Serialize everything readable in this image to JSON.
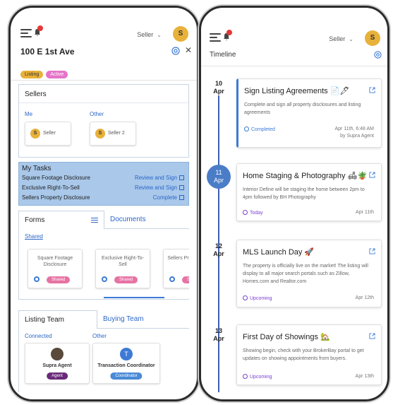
{
  "left": {
    "seller_label": "Seller",
    "avatar_letter": "S",
    "property_title": "100 E 1st Ave",
    "chips": [
      "Listing",
      "Active"
    ],
    "sellers": {
      "title": "Sellers",
      "me_label": "Me",
      "other_label": "Other",
      "me_card": {
        "letter": "S",
        "name": "Seller"
      },
      "other_card": {
        "letter": "S",
        "name": "Seller 2"
      }
    },
    "tasks": {
      "title": "My Tasks",
      "rows": [
        {
          "name": "Square Footage Disclosure",
          "action": "Review and Sign"
        },
        {
          "name": "Exclusive Right-To-Sell",
          "action": "Review and Sign"
        },
        {
          "name": "Sellers Property Disclosure",
          "action": "Complete"
        }
      ]
    },
    "forms_tab": "Forms",
    "documents_tab": "Documents",
    "shared_link": "Shared",
    "form_cards": [
      {
        "name": "Square Footage Disclosure",
        "badge": "Shared"
      },
      {
        "name": "Exclusive Right-To-Sell",
        "badge": "Shared"
      },
      {
        "name": "Sellers Property Disc",
        "badge": "Sh"
      }
    ],
    "listing_team_tab": "Listing Team",
    "buying_team_tab": "Buying Team",
    "connected_label": "Connected",
    "team_other_label": "Other",
    "team_cards": [
      {
        "name": "Supra Agent",
        "badge": "Agent"
      },
      {
        "name": "Transaction Coordinator",
        "badge": "Coordinator",
        "letter": "T"
      }
    ]
  },
  "right": {
    "seller_label": "Seller",
    "avatar_letter": "S",
    "timeline_title": "Timeline",
    "events": [
      {
        "day": "10",
        "month": "Apr",
        "title": "Sign Listing Agreements 📄🖊",
        "desc": "Complete and sign all property disclosures and listing agreements",
        "status": "Completed",
        "date": "Apr 11th, 6:48 AM",
        "by": "by Supra Agent"
      },
      {
        "day": "11",
        "month": "Apr",
        "title": "Home Staging & Photography 🛋🪴",
        "desc": "Interior Define will be staging the home between 2pm to 4pm followed by BH Photography",
        "status": "Today",
        "date": "Apr 11th"
      },
      {
        "day": "12",
        "month": "Apr",
        "title": "MLS Launch Day 🚀",
        "desc": "The property is officially live on the market! The listing will display to all major search portals such as Zillow, Homes.com and Realtor.com",
        "status": "Upcoming",
        "date": "Apr 12th"
      },
      {
        "day": "13",
        "month": "Apr",
        "title": "First Day of Showings 🏡",
        "desc": "Showing begin, check with your BrokerBay portal to get updates on showing appointments from buyers.",
        "status": "Upcoming",
        "date": "Apr 13th"
      }
    ]
  }
}
